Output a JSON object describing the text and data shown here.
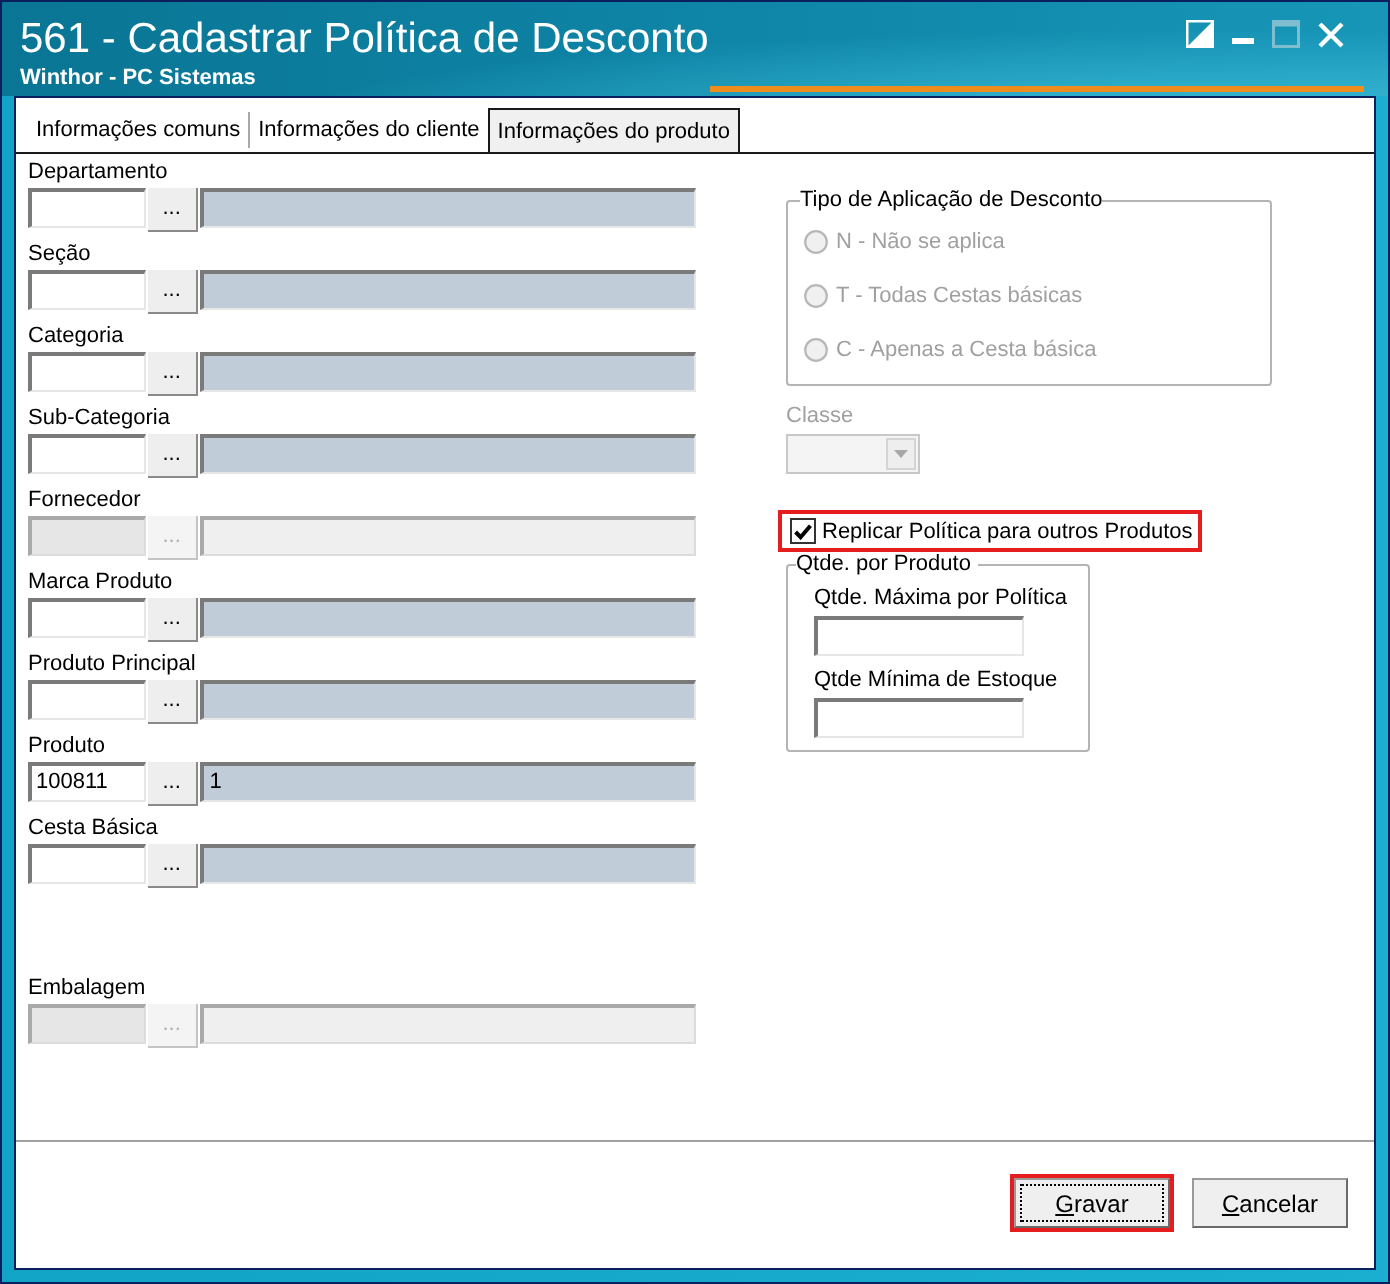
{
  "window": {
    "title": "561 - Cadastrar Política de Desconto",
    "subtitle": "Winthor - PC Sistemas",
    "controls": [
      {
        "kind": "theme",
        "disabled": false
      },
      {
        "kind": "minimize",
        "disabled": false
      },
      {
        "kind": "maximize",
        "disabled": true
      },
      {
        "kind": "close",
        "disabled": false
      }
    ]
  },
  "tabs": [
    {
      "label": "Informações comuns",
      "selected": false
    },
    {
      "label": "Informações do cliente",
      "selected": false
    },
    {
      "label": "Informações do produto",
      "selected": true
    }
  ],
  "lookup_fields": [
    {
      "label": "Departamento",
      "button": "...",
      "disabled": false
    },
    {
      "label": "Seção",
      "button": "...",
      "disabled": false
    },
    {
      "label": "Categoria",
      "button": "...",
      "disabled": false
    },
    {
      "label": "Sub-Categoria",
      "button": "...",
      "disabled": false
    },
    {
      "label": "Fornecedor",
      "button": "...",
      "disabled": true
    },
    {
      "label": "Marca Produto",
      "button": "...",
      "disabled": false
    },
    {
      "label": "Produto Principal",
      "button": "...",
      "disabled": false
    },
    {
      "label": "Produto",
      "code": "100811",
      "button": "...",
      "description": "1",
      "disabled": false
    },
    {
      "label": "Cesta Básica",
      "button": "...",
      "disabled": false
    },
    {
      "label": "Embalagem",
      "button": "...",
      "disabled": true
    }
  ],
  "discount_type": {
    "legend": "Tipo de Aplicação de Desconto",
    "disabled": true,
    "options": [
      {
        "label": "N - Não se aplica",
        "selected": false
      },
      {
        "label": "T - Todas Cestas básicas",
        "selected": false
      },
      {
        "label": "C - Apenas a Cesta básica",
        "selected": false
      }
    ]
  },
  "class_field": {
    "label": "Classe",
    "disabled": true
  },
  "replicate_checkbox": {
    "label": "Replicar Política para outros Produtos",
    "checked": true,
    "highlighted": true
  },
  "quantity_group": {
    "legend": "Qtde. por Produto",
    "fields": [
      {
        "label": "Qtde. Máxima por Política"
      },
      {
        "label": "Qtde Mínima de Estoque"
      }
    ]
  },
  "buttons": [
    {
      "label": "Gravar",
      "mnemonic": true,
      "focused": true,
      "highlighted": true
    },
    {
      "label": "Cancelar",
      "mnemonic": true,
      "focused": false,
      "highlighted": false
    }
  ]
}
